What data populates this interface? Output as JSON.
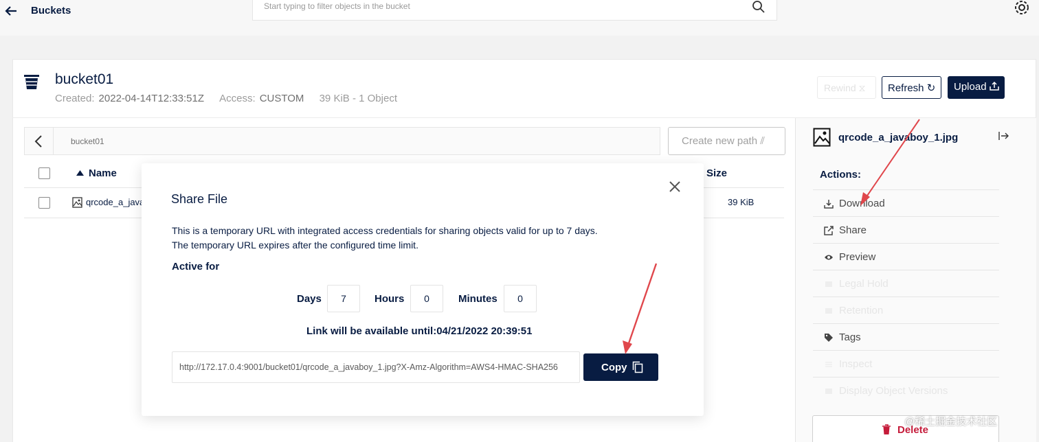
{
  "topbar": {
    "title": "Buckets",
    "search_placeholder": "Start typing to filter objects in the bucket"
  },
  "bucket": {
    "name": "bucket01",
    "created_label": "Created:",
    "created_value": "2022-04-14T12:33:51Z",
    "access_label": "Access:",
    "access_value": "CUSTOM",
    "summary": "39 KiB - 1 Object"
  },
  "toolbar": {
    "rewind_label": "Rewind",
    "refresh_label": "Refresh",
    "upload_label": "Upload"
  },
  "path": {
    "current": "bucket01",
    "create_label": "Create new path"
  },
  "table": {
    "col_name": "Name",
    "col_size": "Size",
    "rows": [
      {
        "name": "qrcode_a_java",
        "size": "39 KiB"
      }
    ]
  },
  "side": {
    "file_name": "qrcode_a_javaboy_1.jpg",
    "actions_title": "Actions:",
    "actions": [
      {
        "label": "Download",
        "icon": "download-icon",
        "enabled": true
      },
      {
        "label": "Share",
        "icon": "share-icon",
        "enabled": true
      },
      {
        "label": "Preview",
        "icon": "eye-icon",
        "enabled": true
      },
      {
        "label": "Legal Hold",
        "icon": "legal-hold-icon",
        "enabled": false
      },
      {
        "label": "Retention",
        "icon": "retention-icon",
        "enabled": false
      },
      {
        "label": "Tags",
        "icon": "tag-icon",
        "enabled": true
      },
      {
        "label": "Inspect",
        "icon": "inspect-icon",
        "enabled": false
      },
      {
        "label": "Display Object Versions",
        "icon": "versions-icon",
        "enabled": false
      }
    ],
    "delete_label": "Delete"
  },
  "modal": {
    "title": "Share File",
    "desc_line1": "This is a temporary URL with integrated access credentials for sharing objects valid for up to 7 days.",
    "desc_line2": "The temporary URL expires after the configured time limit.",
    "active_for": "Active for",
    "days_label": "Days",
    "days_value": "7",
    "hours_label": "Hours",
    "hours_value": "0",
    "minutes_label": "Minutes",
    "minutes_value": "0",
    "available_until": "Link will be available until:04/21/2022 20:39:51",
    "url": "http://172.17.0.4:9001/bucket01/qrcode_a_javaboy_1.jpg?X-Amz-Algorithm=AWS4-HMAC-SHA256",
    "copy_label": "Copy"
  },
  "colors": {
    "primary": "#081c42",
    "danger": "#c51b3a",
    "annotation_arrow": "#e0474c"
  },
  "watermark": "@稀土掘金技术社区"
}
